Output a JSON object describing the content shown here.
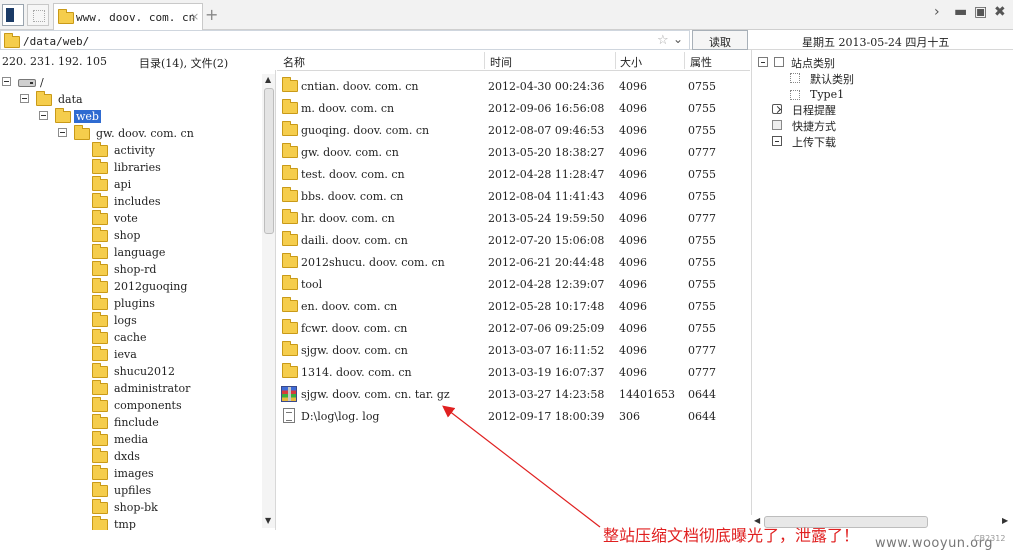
{
  "tab": {
    "title": "www. doov. com. cn",
    "close": "×"
  },
  "window": {
    "add_tab": "+",
    "forward": "›",
    "minimize": "▬",
    "maximize": "▣",
    "close": "✖"
  },
  "address": {
    "path": "/data/web/",
    "star": "☆",
    "dropdown": "⌄",
    "read_button": "读取"
  },
  "datebar": {
    "text": "星期五 2013-05-24 四月十五"
  },
  "infobar": {
    "ip": "220. 231. 192. 105",
    "counts": "目录(14), 文件(2)"
  },
  "tree": {
    "root": "/",
    "data": "data",
    "web": "web",
    "site": "gw. doov. com. cn",
    "children": [
      "activity",
      "libraries",
      "api",
      "includes",
      "vote",
      "shop",
      "language",
      "shop-rd",
      "2012guoqing",
      "plugins",
      "logs",
      "cache",
      "ieva",
      "shucu2012",
      "administrator",
      "components",
      "finclude",
      "media",
      "dxds",
      "images",
      "upfiles",
      "shop-bk",
      "tmp"
    ]
  },
  "list": {
    "headers": {
      "name": "名称",
      "time": "时间",
      "size": "大小",
      "perm": "属性"
    },
    "rows": [
      {
        "type": "folder",
        "name": "cntian. doov. com. cn",
        "time": "2012-04-30 00:24:36",
        "size": "4096",
        "perm": "0755"
      },
      {
        "type": "folder",
        "name": "m. doov. com. cn",
        "time": "2012-09-06 16:56:08",
        "size": "4096",
        "perm": "0755"
      },
      {
        "type": "folder",
        "name": "guoqing. doov. com. cn",
        "time": "2012-08-07 09:46:53",
        "size": "4096",
        "perm": "0755"
      },
      {
        "type": "folder",
        "name": "gw. doov. com. cn",
        "time": "2013-05-20 18:38:27",
        "size": "4096",
        "perm": "0777"
      },
      {
        "type": "folder",
        "name": "test. doov. com. cn",
        "time": "2012-04-28 11:28:47",
        "size": "4096",
        "perm": "0755"
      },
      {
        "type": "folder",
        "name": "bbs. doov. com. cn",
        "time": "2012-08-04 11:41:43",
        "size": "4096",
        "perm": "0755"
      },
      {
        "type": "folder",
        "name": "hr. doov. com. cn",
        "time": "2013-05-24 19:59:50",
        "size": "4096",
        "perm": "0777"
      },
      {
        "type": "folder",
        "name": "daili. doov. com. cn",
        "time": "2012-07-20 15:06:08",
        "size": "4096",
        "perm": "0755"
      },
      {
        "type": "folder",
        "name": "2012shucu. doov. com. cn",
        "time": "2012-06-21 20:44:48",
        "size": "4096",
        "perm": "0755"
      },
      {
        "type": "folder",
        "name": "tool",
        "time": "2012-04-28 12:39:07",
        "size": "4096",
        "perm": "0755"
      },
      {
        "type": "folder",
        "name": "en. doov. com. cn",
        "time": "2012-05-28 10:17:48",
        "size": "4096",
        "perm": "0755"
      },
      {
        "type": "folder",
        "name": "fcwr. doov. com. cn",
        "time": "2012-07-06 09:25:09",
        "size": "4096",
        "perm": "0755"
      },
      {
        "type": "folder",
        "name": "sjgw. doov. com. cn",
        "time": "2013-03-07 16:11:52",
        "size": "4096",
        "perm": "0777"
      },
      {
        "type": "folder",
        "name": "1314. doov. com. cn",
        "time": "2013-03-19 16:07:37",
        "size": "4096",
        "perm": "0777"
      },
      {
        "type": "archive",
        "name": "sjgw. doov. com. cn. tar. gz",
        "time": "2013-03-27 14:23:58",
        "size": "14401653",
        "perm": "0644"
      },
      {
        "type": "doc",
        "name": "D:\\log\\log. log",
        "time": "2012-09-17 18:00:39",
        "size": "306",
        "perm": "0644"
      }
    ]
  },
  "rpanel": {
    "site_category": "站点类别",
    "default_category": "默认类别",
    "type1": "Type1",
    "schedule": "日程提醒",
    "shortcuts": "快捷方式",
    "upload_download": "上传下载"
  },
  "scroll": {
    "up": "▲",
    "down": "▼",
    "left": "◀",
    "right": "▶"
  },
  "annotation": {
    "text": "整站压缩文档彻底曝光了，泄露了！",
    "color": "#e02020"
  },
  "watermark": {
    "text": "www.wooyun.org",
    "corner": "CB2312"
  }
}
